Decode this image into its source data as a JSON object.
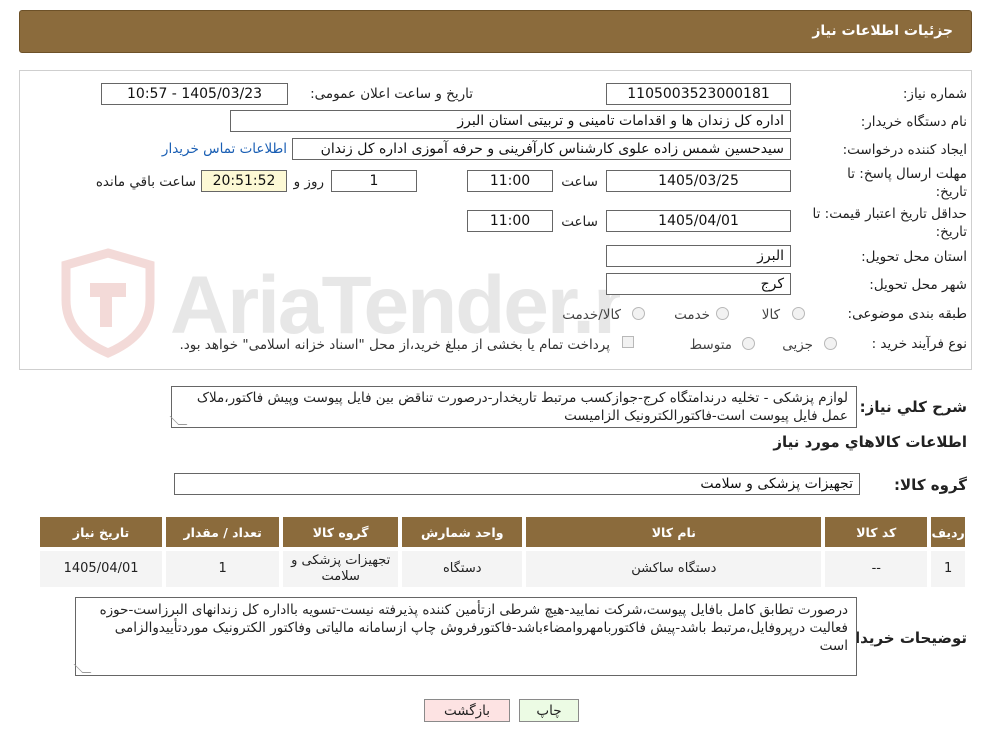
{
  "header": {
    "title": "جزئیات اطلاعات نیاز"
  },
  "fields": {
    "need_number_label": "شماره نیاز:",
    "need_number": "1105003523000181",
    "announce_label": "تاریخ و ساعت اعلان عمومی:",
    "announce_value": "1405/03/23 - 10:57",
    "buyer_org_label": "نام دستگاه خریدار:",
    "buyer_org": "اداره کل زندان ها و اقدامات تامینی و تربیتی استان البرز",
    "requester_label": "ایجاد کننده درخواست:",
    "requester": "سیدحسین شمس زاده علوی کارشناس کارآفرینی و حرفه آموزی اداره کل زندان",
    "contact_link": "اطلاعات تماس خریدار",
    "deadline_label_1": "مهلت ارسال پاسخ: تا",
    "deadline_label_2": "تاریخ:",
    "deadline_date": "1405/03/25",
    "time_label": "ساعت",
    "deadline_time": "11:00",
    "days_value": "1",
    "days_label": "روز و",
    "remaining_time": "20:51:52",
    "remaining_label": "ساعت باقي مانده",
    "validity_label_1": "حداقل تاریخ اعتبار قیمت: تا",
    "validity_label_2": "تاریخ:",
    "validity_date": "1405/04/01",
    "validity_time": "11:00",
    "province_label": "استان محل تحویل:",
    "province": "البرز",
    "city_label": "شهر محل تحویل:",
    "city": "کرج",
    "category_label": "طبقه بندی موضوعی:",
    "category_options": [
      "کالا",
      "خدمت",
      "کالا/خدمت"
    ],
    "process_label": "نوع فرآیند خرید :",
    "process_options": [
      "جزیی",
      "متوسط"
    ],
    "process_note": "پرداخت تمام یا بخشی از مبلغ خرید،از محل \"اسناد خزانه اسلامی\" خواهد بود."
  },
  "watermark": {
    "text": "AriaTender.neT"
  },
  "description": {
    "label": "شرح کلي نياز:",
    "text": "لوازم پزشکی - تخلیه درندامتگاه کرج-جوازکسب مرتبط تاریخدار-درصورت تناقض بین فایل پیوست وپیش فاکتور،ملاک عمل فایل پیوست است-فاکتورالکترونیک الزامیست"
  },
  "goods_info_title": "اطلاعات کالاهاي مورد نياز",
  "goods_group": {
    "label": "گروه کالا:",
    "value": "تجهیزات پزشکی و سلامت"
  },
  "table": {
    "headers": [
      "رديف",
      "کد کالا",
      "نام کالا",
      "واحد شمارش",
      "گروه کالا",
      "تعداد / مقدار",
      "تاریخ نیاز"
    ],
    "rows": [
      [
        "1",
        "--",
        "دستگاه ساکشن",
        "دستگاه",
        "تجهیزات پزشکی و سلامت",
        "1",
        "1405/04/01"
      ]
    ]
  },
  "buyer_notes": {
    "label": "توضیحات خریدار:",
    "text": "درصورت تطابق کامل بافایل پیوست،شرکت نمایید-هیچ شرطی ازتأمین کننده پذیرفته نیست-تسویه بااداره کل زندانهای البرزاست-حوزه فعالیت درپروفایل،مرتبط باشد-پیش فاکتوربامهروامضاءباشد-فاکتورفروش چاپ ازسامانه مالیاتی وفاکتور الکترونیک موردتأییدوالزامی است"
  },
  "buttons": {
    "print": "چاپ",
    "back": "بازگشت"
  },
  "colors": {
    "header_bg": "#8b6b3c",
    "link": "#1a5fb4",
    "back_button_bg": "#fde3e3",
    "print_button_bg": "#ecfbe4",
    "countdown_bg": "#fdf9d5"
  }
}
